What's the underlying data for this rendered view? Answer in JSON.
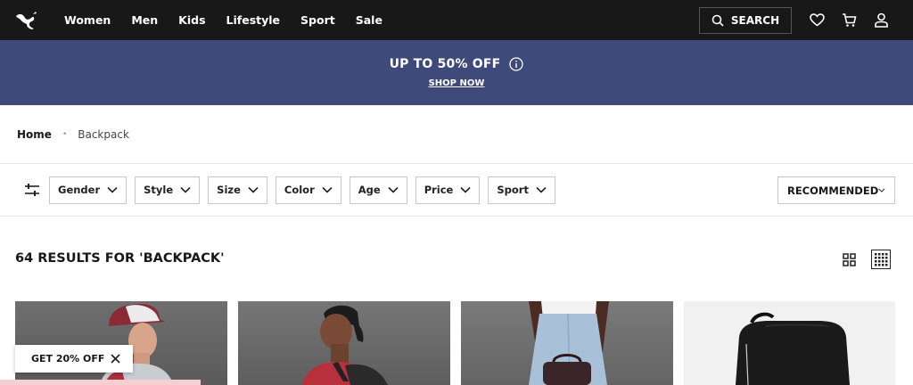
{
  "nav": {
    "logo": "puma-logo",
    "links": [
      "Women",
      "Men",
      "Kids",
      "Lifestyle",
      "Sport",
      "Sale"
    ],
    "search_label": "SEARCH",
    "icons": [
      "heart-icon",
      "cart-icon",
      "user-icon"
    ]
  },
  "promo": {
    "title": "UP TO 50% OFF",
    "cta": "SHOP NOW",
    "bg_color": "#3e4a7a"
  },
  "breadcrumb": {
    "home": "Home",
    "separator": "•",
    "current": "Backpack"
  },
  "filters": {
    "items": [
      "Gender",
      "Style",
      "Size",
      "Color",
      "Age",
      "Price",
      "Sport"
    ],
    "sort_label": "RECOMMENDED"
  },
  "results": {
    "title": "64 RESULTS FOR 'BACKPACK'"
  },
  "coupon": {
    "label": "GET 20% OFF"
  }
}
